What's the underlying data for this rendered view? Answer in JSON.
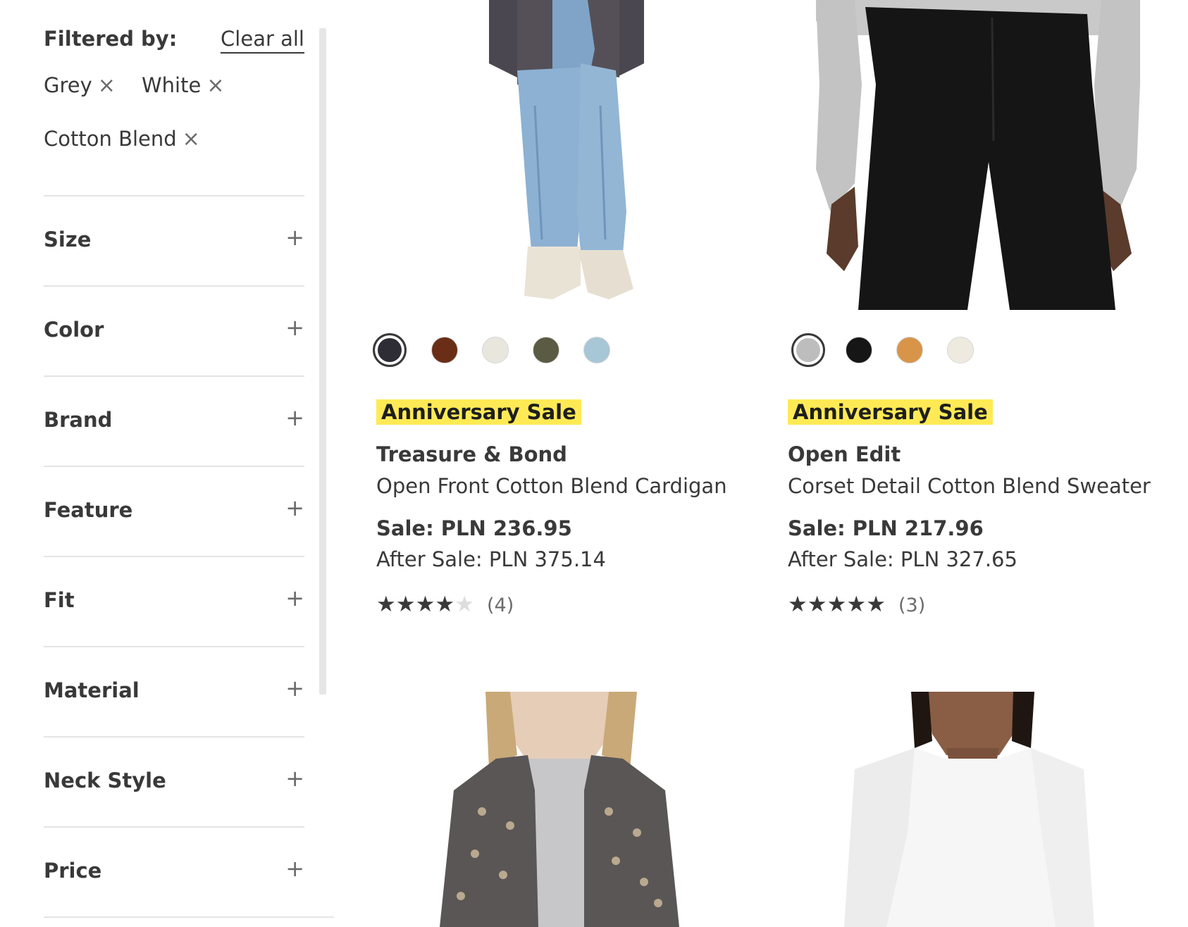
{
  "filters": {
    "heading": "Filtered by:",
    "clear_all": "Clear all",
    "active": [
      {
        "label": "Grey",
        "remove": "×"
      },
      {
        "label": "White",
        "remove": "×"
      },
      {
        "label": "Cotton Blend",
        "remove": "×"
      }
    ],
    "facets": [
      {
        "label": "Size",
        "icon": "+"
      },
      {
        "label": "Color",
        "icon": "+"
      },
      {
        "label": "Brand",
        "icon": "+"
      },
      {
        "label": "Feature",
        "icon": "+"
      },
      {
        "label": "Fit",
        "icon": "+"
      },
      {
        "label": "Material",
        "icon": "+"
      },
      {
        "label": "Neck Style",
        "icon": "+"
      },
      {
        "label": "Price",
        "icon": "+"
      }
    ]
  },
  "products": [
    {
      "badge": "Anniversary Sale",
      "brand": "Treasure & Bond",
      "name": "Open Front Cotton Blend Cardigan",
      "sale_price": "Sale: PLN 236.95",
      "after_price": "After Sale: PLN 375.14",
      "rating": 4,
      "rating_max": 5,
      "review_count": "(4)",
      "swatches": [
        "#2e2c35",
        "#6a2e16",
        "#e9e6de",
        "#5b5a42",
        "#a7c7d6"
      ],
      "selected_swatch": 0
    },
    {
      "badge": "Anniversary Sale",
      "brand": "Open Edit",
      "name": "Corset Detail Cotton Blend Sweater",
      "sale_price": "Sale: PLN 217.96",
      "after_price": "After Sale: PLN 327.65",
      "rating": 5,
      "rating_max": 5,
      "review_count": "(3)",
      "swatches": [
        "#bdbdbd",
        "#161616",
        "#d8954a",
        "#eeeadf"
      ],
      "selected_swatch": 0
    }
  ],
  "colors": {
    "badge": "#ffea55",
    "text": "#393939",
    "divider": "#e4e4e4"
  }
}
